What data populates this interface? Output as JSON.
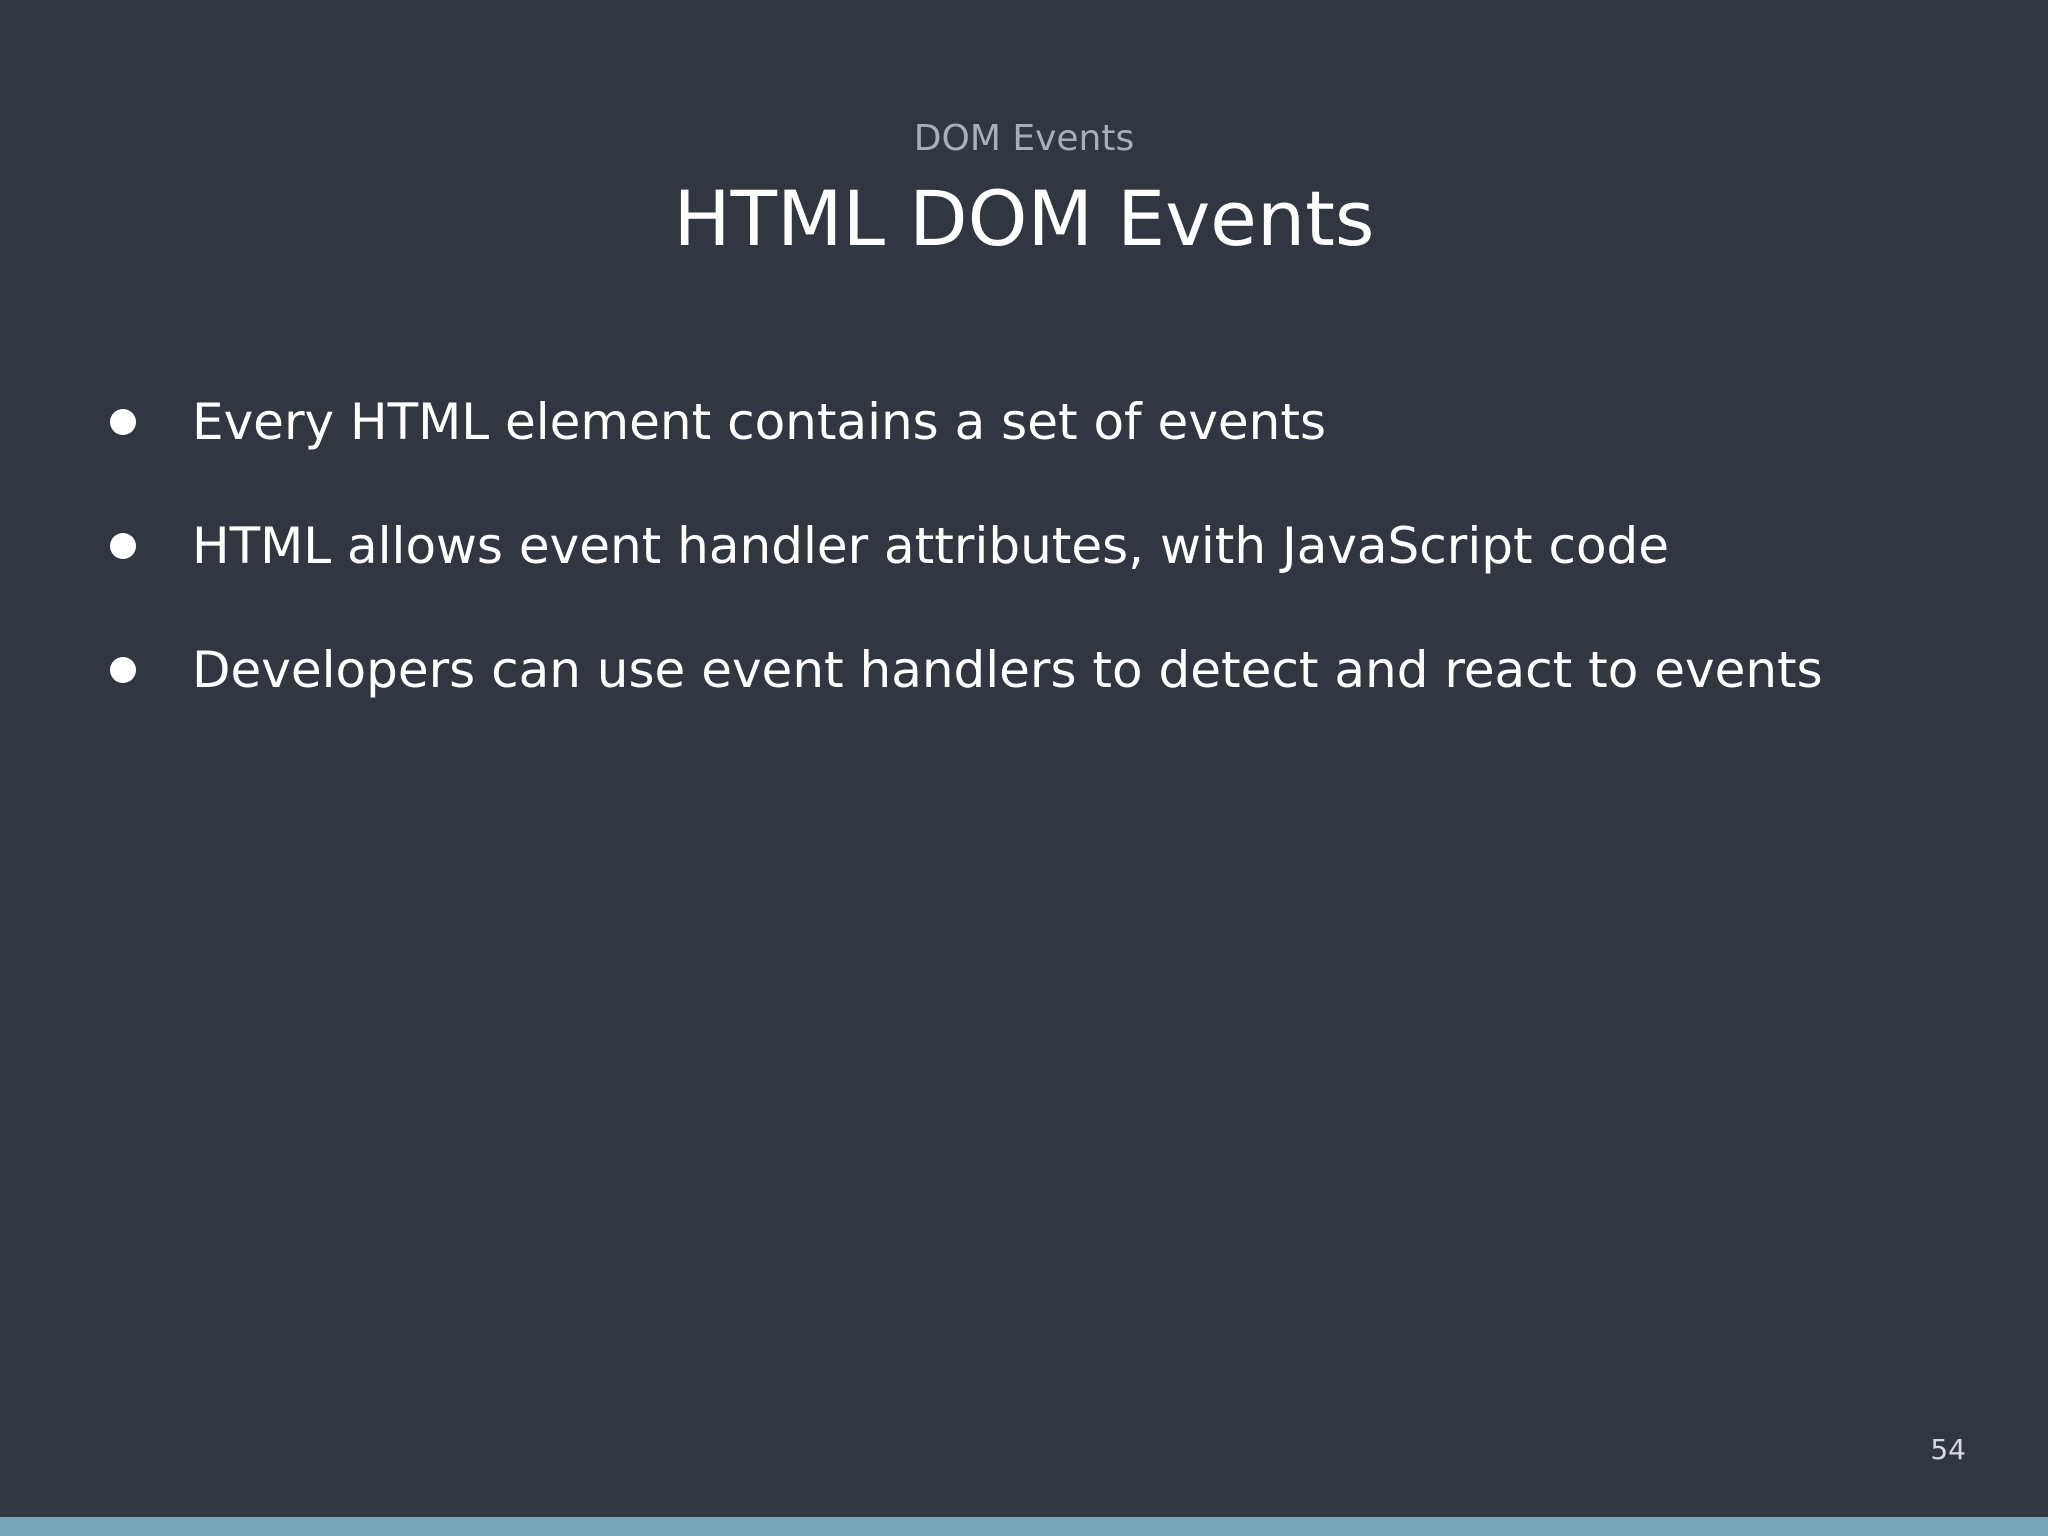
{
  "slide": {
    "subtitle": "DOM Events",
    "title": "HTML DOM Events",
    "bullets": [
      "Every HTML element contains a set of events",
      "HTML allows event handler attributes, with JavaScript code",
      "Developers can use event handlers to detect and react to events"
    ],
    "page_number": "54"
  },
  "colors": {
    "background": "#323641",
    "title_text": "#ffffff",
    "subtitle_text": "#a9adb5",
    "bottom_bar": "#77a7b7"
  }
}
